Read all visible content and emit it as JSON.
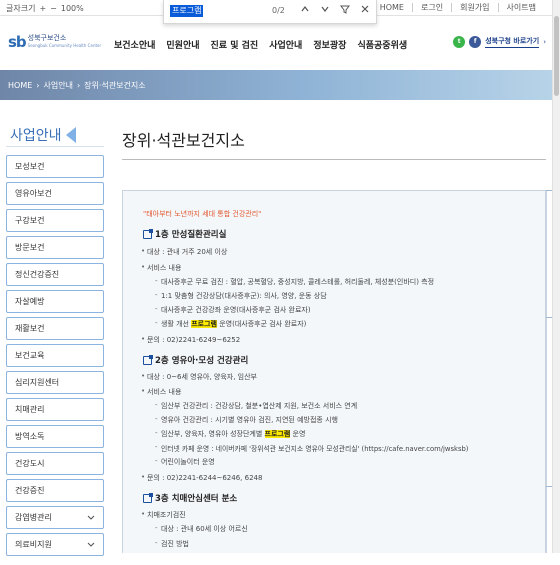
{
  "utility": {
    "font_size_label": "글자크기",
    "zoom_in": "+",
    "zoom_out": "−",
    "zoom_value": "100%",
    "links": [
      "HOME",
      "로그인",
      "회원가입",
      "사이트맵"
    ]
  },
  "find": {
    "query": "프로그램",
    "count": "0/2"
  },
  "header": {
    "logo_mark": "sb",
    "logo_name": "성북구보건소",
    "logo_sub": "Seongbuk Community Health Center",
    "nav": [
      "보건소안내",
      "민원안내",
      "진료 및 검진",
      "사업안내",
      "정보광장",
      "식품공중위생"
    ],
    "go_link": "성북구청 바로가기"
  },
  "breadcrumb": [
    "HOME",
    "사업안내",
    "장위·석관보건지소"
  ],
  "sidebar": {
    "title": "사업안내",
    "items": [
      {
        "label": "모성보건",
        "chevron": false
      },
      {
        "label": "영유아보건",
        "chevron": false
      },
      {
        "label": "구강보건",
        "chevron": false
      },
      {
        "label": "방문보건",
        "chevron": false
      },
      {
        "label": "정신건강증진",
        "chevron": false
      },
      {
        "label": "자살예방",
        "chevron": false
      },
      {
        "label": "재활보건",
        "chevron": false
      },
      {
        "label": "보건교육",
        "chevron": false
      },
      {
        "label": "심리지원센터",
        "chevron": false
      },
      {
        "label": "치매관리",
        "chevron": false
      },
      {
        "label": "방역소독",
        "chevron": false
      },
      {
        "label": "건강도시",
        "chevron": false
      },
      {
        "label": "건강증진",
        "chevron": false
      },
      {
        "label": "감염병관리",
        "chevron": true
      },
      {
        "label": "의료비지원",
        "chevron": true
      }
    ]
  },
  "content": {
    "title": "장위·석관보건지소",
    "motto": "\"태아부터 노년까지 세대 통합 건강관리\"",
    "sec1": {
      "heading": "1층 만성질환관리실",
      "target": "대상 : 관내 거주 20세 이상",
      "services_label": "서비스 내용",
      "s1": "대사증후군 무료 검진 : 혈압, 공복혈당, 중성지방, 콜레스테롤, 허리둘레, 체성분(인바디) 측정",
      "s2": "1:1 맞춤형 건강상담(대사증후군): 의사, 영양, 운동 상담",
      "s3": "대사증후군 건강강좌 운영(대사증후군 검사 완료자)",
      "s4_pre": "생활 개선 ",
      "s4_hl": "프로그램",
      "s4_post": " 운영(대사증후군 검사 완료자)",
      "contact": "문의 : 02)2241-6249~6252"
    },
    "sec2": {
      "heading": "2층 영유아·모성 건강관리",
      "target": "대상 : 0~6세 영유아, 양육자, 임산부",
      "services_label": "서비스 내용",
      "s1": "임산부 건강관리 : 건강상담, 철분•엽산제 지원, 보건소 서비스 연계",
      "s2": "영유아 건강관리 : 시기별 영유아 검진, 지연된 예방접종 시행",
      "s3_pre": "임산부, 양육자, 영유아 성장단계별 ",
      "s3_hl": "프로그램",
      "s3_post": " 운영",
      "s4": "인터넷 카페 운영 : 네이버카페 '장위석관 보건지소 영유아 모성관리실' (https://cafe.naver.com/jwsksb)",
      "s5": "어린이놀이터 운영",
      "contact": "문의 : 02)2241-6244~6246, 6248"
    },
    "sec3": {
      "heading": "3층 치매안심센터 분소",
      "l1": "치매조기검진",
      "l2": "대상 : 관내 60세 이상 어르신",
      "l3": "검진 방법"
    }
  },
  "colors": {
    "accent": "#3a70b8",
    "menu_border": "#8bb4e0",
    "highlight": "#ffeb00",
    "motto": "#e2572f"
  }
}
